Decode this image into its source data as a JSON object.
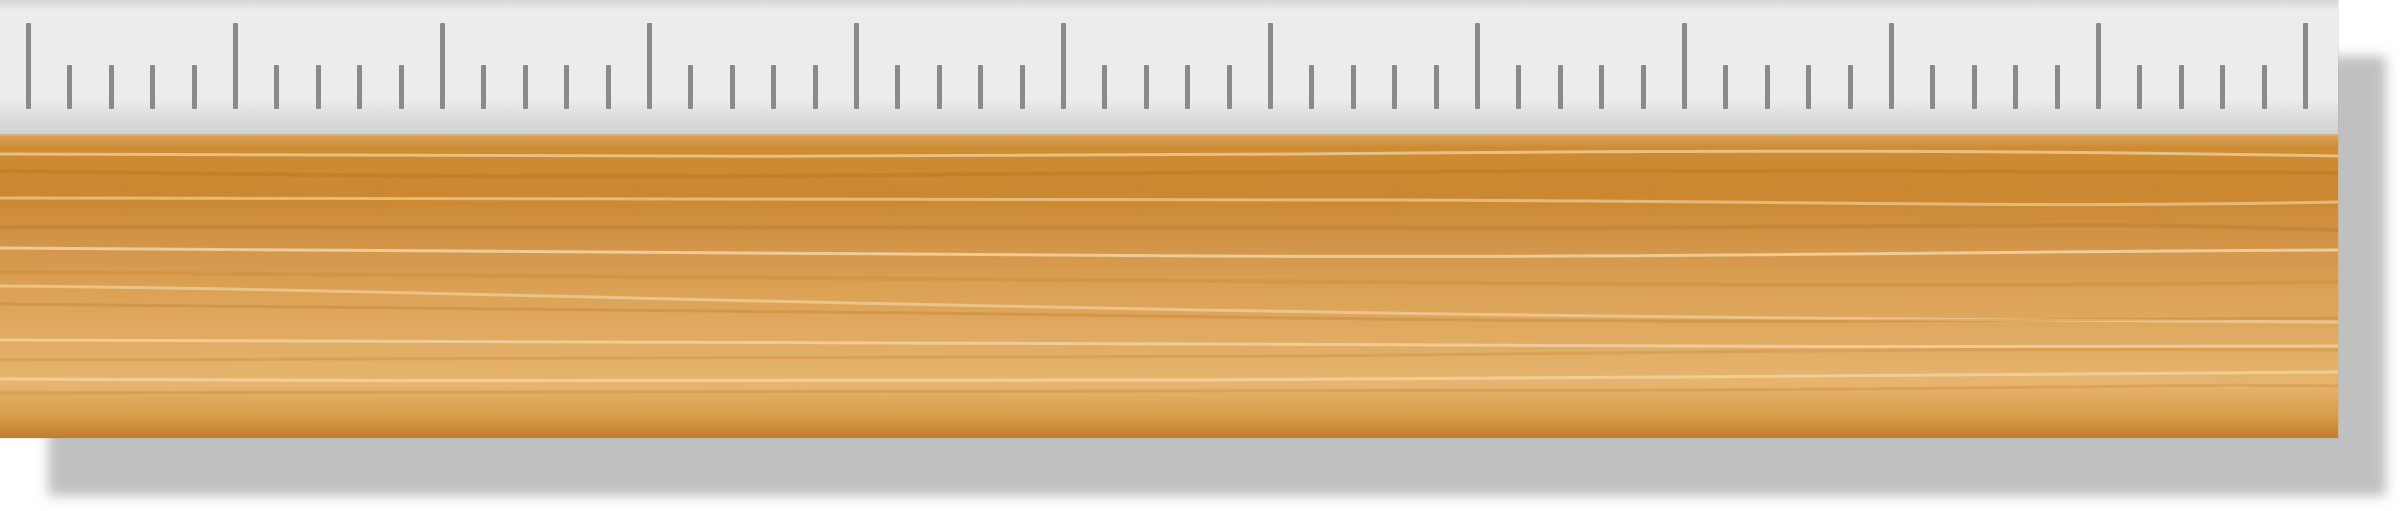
{
  "ruler": {
    "major_ticks": 12,
    "minor_ticks_per_segment": 4,
    "colors": {
      "scale_background": "#ececeb",
      "tick_color": "#8a8b89",
      "wood_base": "#dca356",
      "wood_dark": "#cb8830",
      "shadow": "#bfc1c0"
    }
  }
}
